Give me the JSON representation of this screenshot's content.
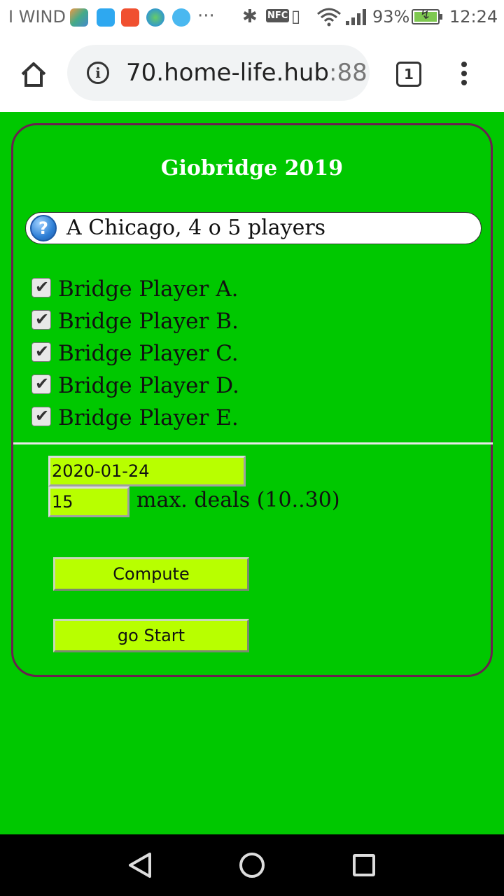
{
  "status_bar": {
    "carrier": "I WIND",
    "nfc_label": "NFC",
    "battery_percent": "93%",
    "time": "12:24",
    "icons": [
      "app-icon",
      "usb-icon",
      "shop-icon",
      "globe-icon",
      "bird-icon",
      "more-icon",
      "bluetooth-icon",
      "nfc-icon",
      "vibrate-icon",
      "wifi-icon",
      "signal-icon",
      "battery-charging-icon"
    ]
  },
  "browser": {
    "url_host": "70.home-life.hub",
    "url_port": ":88",
    "tab_count": "1"
  },
  "page": {
    "title": "Giobridge 2019",
    "mode_help": "?",
    "mode_label": "A Chicago, 4 o 5 players",
    "players": [
      {
        "label": "Bridge Player A.",
        "checked": true
      },
      {
        "label": "Bridge Player B.",
        "checked": true
      },
      {
        "label": "Bridge Player C.",
        "checked": true
      },
      {
        "label": "Bridge Player D.",
        "checked": true
      },
      {
        "label": "Bridge Player E.",
        "checked": true
      }
    ],
    "date_value": "2020-01-24",
    "deals_value": "15",
    "deals_label": "max. deals (10..30)",
    "compute_label": "Compute",
    "start_label": "go Start"
  },
  "colors": {
    "page_background": "#00c800",
    "input_background": "#b8ff00",
    "card_border": "#6a2050"
  }
}
